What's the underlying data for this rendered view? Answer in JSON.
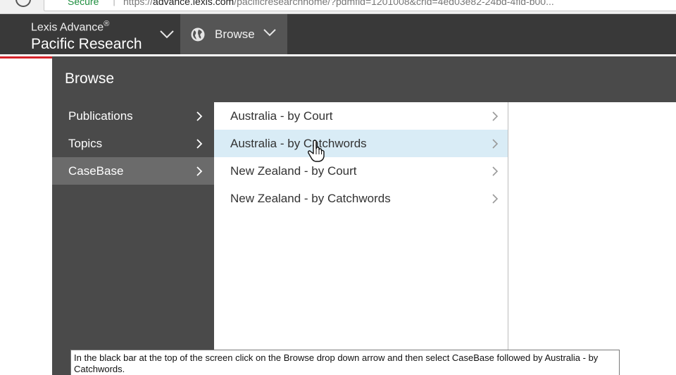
{
  "browser": {
    "secure_label": "Secure",
    "separator": "|",
    "url_prefix": "https://",
    "url_host": "advance.lexis.com",
    "url_path": "/pacificresearchhome/?pdmfid=1201008&crid=4ed03e82-24bd-4fld-b00..."
  },
  "header": {
    "brand_line1": "Lexis Advance",
    "brand_registered": "®",
    "brand_line2": "Pacific Research",
    "browse_label": "Browse"
  },
  "browse_panel": {
    "title": "Browse",
    "categories": [
      {
        "label": "Publications"
      },
      {
        "label": "Topics"
      },
      {
        "label": "CaseBase"
      }
    ],
    "active_category": "CaseBase",
    "subitems": [
      {
        "label": "Australia - by Court"
      },
      {
        "label": "Australia - by Catchwords"
      },
      {
        "label": "New Zealand - by Court"
      },
      {
        "label": "New Zealand - by Catchwords"
      }
    ],
    "hovered_subitem": "Australia - by Catchwords"
  },
  "caption": {
    "text": "In the black bar at the top of the screen click on the Browse drop down arrow and then select CaseBase followed by Australia - by Catchwords."
  },
  "colors": {
    "header_bg": "#393939",
    "panel_bg": "#4a4a4a",
    "active_item_bg": "#6b6b6b",
    "hover_item_bg": "#d9ecf6",
    "accent_red": "#d6232a"
  }
}
